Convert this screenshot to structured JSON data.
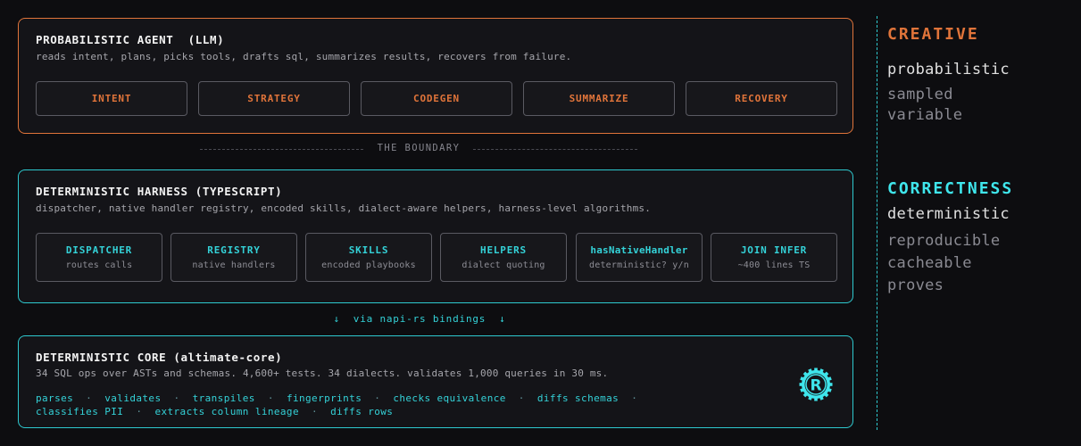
{
  "agent": {
    "title": "PROBABILISTIC AGENT  (LLM)",
    "description": "reads intent, plans, picks tools, drafts sql, summarizes results, recovers from failure.",
    "chips": [
      "INTENT",
      "STRATEGY",
      "CODEGEN",
      "SUMMARIZE",
      "RECOVERY"
    ]
  },
  "boundary": {
    "label": "THE BOUNDARY"
  },
  "harness": {
    "title": "DETERMINISTIC HARNESS (TYPESCRIPT)",
    "description": "dispatcher, native handler registry, encoded skills, dialect-aware helpers, harness-level algorithms.",
    "chips": [
      {
        "label": "DISPATCHER",
        "sub": "routes calls"
      },
      {
        "label": "REGISTRY",
        "sub": "native handlers"
      },
      {
        "label": "SKILLS",
        "sub": "encoded playbooks"
      },
      {
        "label": "HELPERS",
        "sub": "dialect quoting"
      },
      {
        "label": "hasNativeHandler",
        "sub": "deterministic? y/n"
      },
      {
        "label": "JOIN INFER",
        "sub": "~400 lines TS"
      }
    ]
  },
  "bindings": {
    "label": "↓  via napi-rs bindings  ↓"
  },
  "core": {
    "title": "DETERMINISTIC CORE (altimate-core)",
    "description": "34 SQL ops over ASTs and schemas. 4,600+ tests. 34 dialects. validates 1,000 queries in 30 ms.",
    "capabilities_line1": [
      "parses",
      "validates",
      "transpiles",
      "fingerprints",
      "checks equivalence",
      "diffs schemas"
    ],
    "capabilities_line2": [
      "classifies PII",
      "extracts column lineage",
      "diffs rows"
    ],
    "separator": "·",
    "logo_icon": "rust-logo-icon"
  },
  "legend": {
    "creative": {
      "heading": "CREATIVE",
      "main": "probabilistic",
      "subs": [
        "sampled",
        "variable"
      ],
      "color": "#e0743a"
    },
    "correctness": {
      "heading": "CORRECTNESS",
      "main": "deterministic",
      "subs": [
        "reproducible",
        "cacheable",
        "proves"
      ],
      "color": "#3fe6ec"
    }
  }
}
